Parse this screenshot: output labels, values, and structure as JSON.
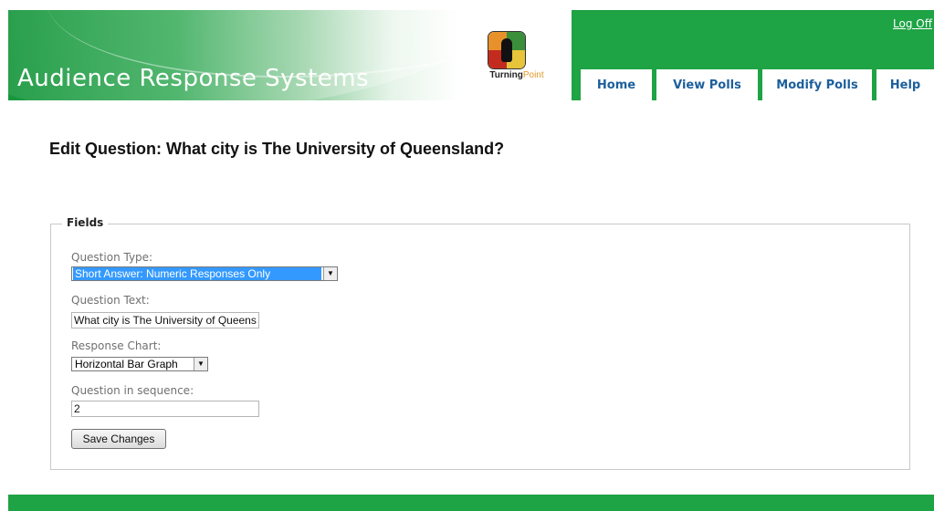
{
  "header": {
    "app_title": "Audience Response Systems",
    "logo": {
      "icon": "turningpoint-logo-icon",
      "brand_bold": "Turning",
      "brand_light": "Point"
    },
    "logoff_label": "Log Off",
    "tabs": [
      {
        "label": "Home"
      },
      {
        "label": "View Polls"
      },
      {
        "label": "Modify Polls"
      },
      {
        "label": "Help"
      }
    ]
  },
  "main": {
    "page_title": "Edit Question: What city is The University of Queensland?",
    "fieldset_legend": "Fields",
    "question_type": {
      "label": "Question Type:",
      "selected": "Short Answer: Numeric Responses Only"
    },
    "question_text": {
      "label": "Question Text:",
      "value": "What city is The University of Queensland?"
    },
    "response_chart": {
      "label": "Response Chart:",
      "selected": "Horizontal Bar Graph"
    },
    "sequence": {
      "label": "Question in sequence:",
      "value": "2"
    },
    "save_label": "Save Changes"
  },
  "colors": {
    "brand_green": "#1ea345",
    "tab_text": "#1c5f9c",
    "selection": "#3399ff"
  }
}
